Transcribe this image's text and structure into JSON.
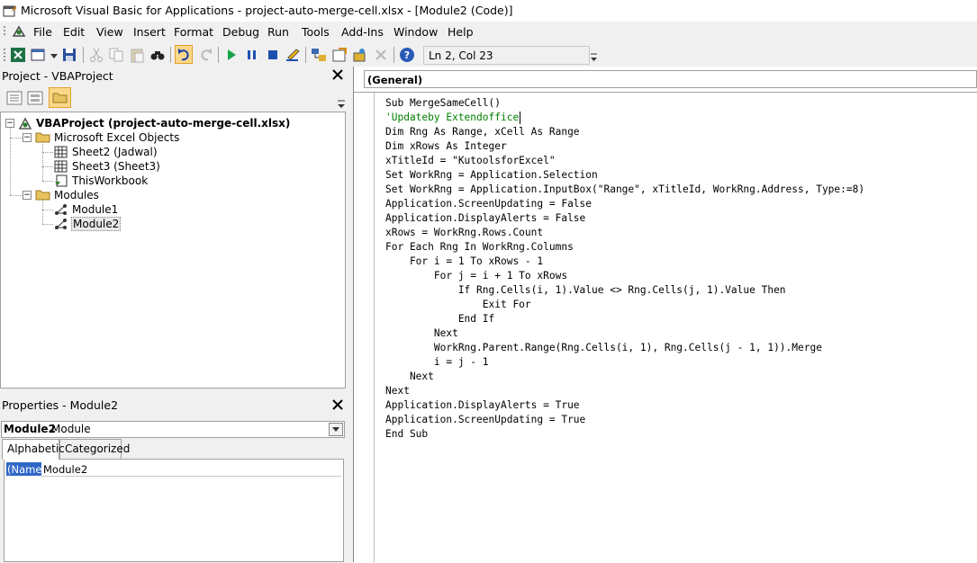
{
  "window": {
    "title": "Microsoft Visual Basic for Applications - project-auto-merge-cell.xlsx - [Module2 (Code)]"
  },
  "menu": [
    {
      "label": "File"
    },
    {
      "label": "Edit"
    },
    {
      "label": "View"
    },
    {
      "label": "Insert"
    },
    {
      "label": "Format"
    },
    {
      "label": "Debug"
    },
    {
      "label": "Run"
    },
    {
      "label": "Tools"
    },
    {
      "label": "Add-Ins"
    },
    {
      "label": "Window"
    },
    {
      "label": "Help"
    }
  ],
  "toolbar": {
    "position": "Ln 2, Col 23"
  },
  "project": {
    "pane_title": "Project - VBAProject",
    "root": "VBAProject (project-auto-merge-cell.xlsx)",
    "excel_objects": "Microsoft Excel Objects",
    "sheet2": "Sheet2 (Jadwal)",
    "sheet3": "Sheet3 (Sheet3)",
    "workbook": "ThisWorkbook",
    "modules": "Modules",
    "module1": "Module1",
    "module2": "Module2"
  },
  "properties": {
    "pane_title": "Properties - Module2",
    "object_name": "Module2",
    "object_type": "Module",
    "tab_alpha": "Alphabetic",
    "tab_cat": "Categorized",
    "prop_name": "(Name)",
    "prop_value": "Module2"
  },
  "code": {
    "object_combo": "(General)",
    "lines": [
      "Sub MergeSameCell()",
      "'Updateby Extendoffice",
      "Dim Rng As Range, xCell As Range",
      "Dim xRows As Integer",
      "xTitleId = \"KutoolsforExcel\"",
      "Set WorkRng = Application.Selection",
      "Set WorkRng = Application.InputBox(\"Range\", xTitleId, WorkRng.Address, Type:=8)",
      "Application.ScreenUpdating = False",
      "Application.DisplayAlerts = False",
      "xRows = WorkRng.Rows.Count",
      "For Each Rng In WorkRng.Columns",
      "    For i = 1 To xRows - 1",
      "        For j = i + 1 To xRows",
      "            If Rng.Cells(i, 1).Value <> Rng.Cells(j, 1).Value Then",
      "                Exit For",
      "            End If",
      "        Next",
      "        WorkRng.Parent.Range(Rng.Cells(i, 1), Rng.Cells(j - 1, 1)).Merge",
      "        i = j - 1",
      "    Next",
      "Next",
      "Application.DisplayAlerts = True",
      "Application.ScreenUpdating = True",
      "End Sub"
    ]
  }
}
